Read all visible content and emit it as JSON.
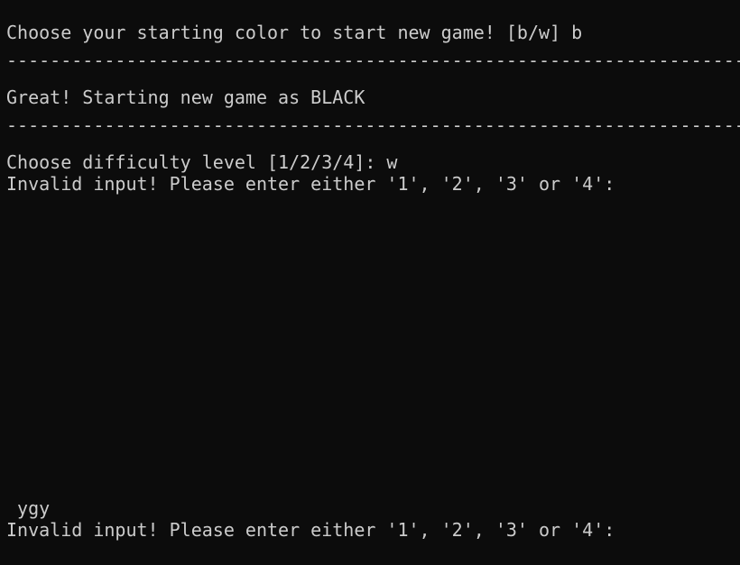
{
  "terminal": {
    "lines": {
      "prompt_color": "Choose your starting color to start new game! [b/w] b",
      "separator_1": "----------------------------------------------------------------------",
      "start_message": "Great! Starting new game as BLACK",
      "separator_2": "----------------------------------------------------------------------",
      "prompt_difficulty": "Choose difficulty level [1/2/3/4]: w",
      "error_1": "Invalid input! Please enter either '1', '2', '3' or '4':",
      "typed_input": " ygy",
      "error_2": "Invalid input! Please enter either '1', '2', '3' or '4':"
    }
  },
  "colors": {
    "background": "#0c0c0c",
    "text": "#cccccc"
  }
}
